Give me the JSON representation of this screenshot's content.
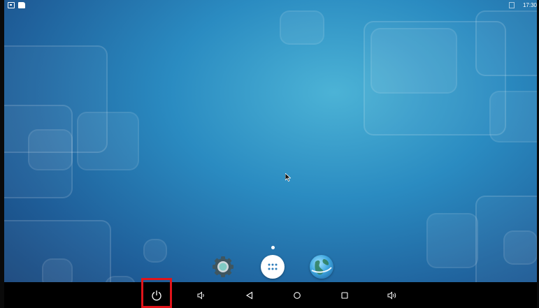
{
  "status_bar": {
    "left_icons": [
      "notification-icon",
      "sd-card-icon"
    ],
    "right_icons": [
      "no-signal-icon"
    ],
    "time": "17:30"
  },
  "home_screen": {
    "page_indicator": {
      "pages": 1,
      "current": 1
    },
    "dock": [
      {
        "name": "settings",
        "icon": "settings-gear-icon"
      },
      {
        "name": "all-apps",
        "icon": "app-drawer-icon"
      },
      {
        "name": "browser",
        "icon": "globe-icon"
      }
    ]
  },
  "nav_bar": {
    "buttons": [
      {
        "name": "power",
        "icon": "power-icon",
        "highlighted": true
      },
      {
        "name": "volume-down",
        "icon": "volume-down-icon"
      },
      {
        "name": "back",
        "icon": "back-triangle-icon"
      },
      {
        "name": "home",
        "icon": "home-circle-icon"
      },
      {
        "name": "recents",
        "icon": "recents-square-icon"
      },
      {
        "name": "volume-up",
        "icon": "volume-up-icon"
      }
    ],
    "highlight_color": "#e0141b"
  },
  "colors": {
    "wallpaper_light": "#4cb3d6",
    "wallpaper_dark": "#163f74",
    "nav_background": "#000000"
  }
}
